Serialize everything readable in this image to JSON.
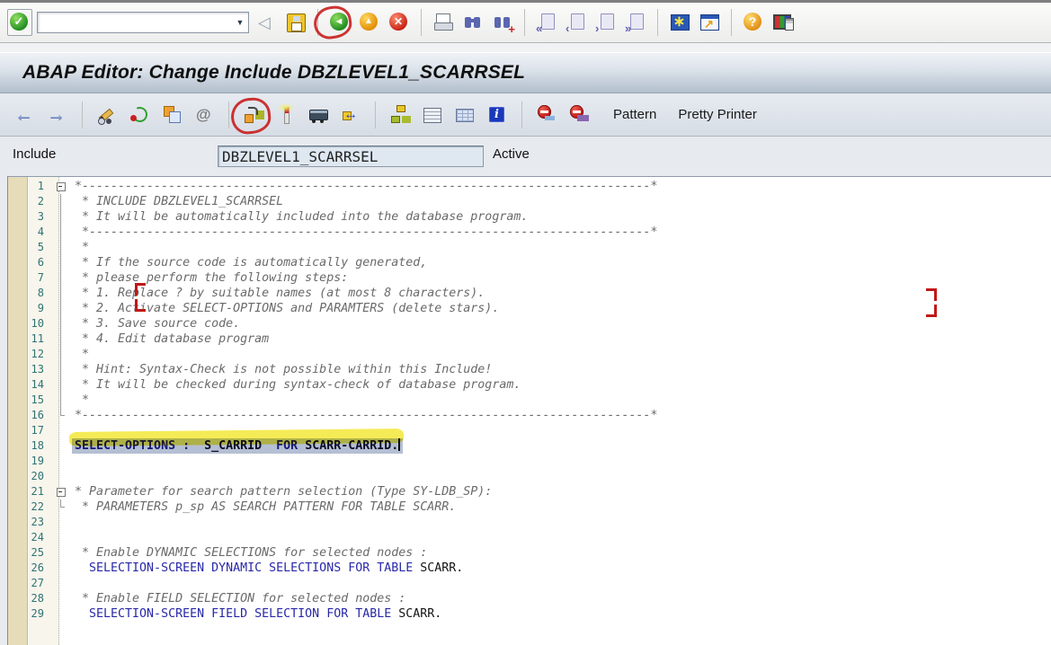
{
  "window": {
    "title": "ABAP Editor: Change Include DBZLEVEL1_SCARRSEL"
  },
  "toolbar_top": {
    "command_field": {
      "value": "",
      "placeholder": ""
    },
    "items": [
      {
        "type": "button",
        "icon": "enter-icon",
        "name": "enter-button",
        "raised": true
      },
      {
        "type": "combo"
      },
      {
        "type": "button",
        "icon": "back-icon",
        "name": "back-button"
      },
      {
        "type": "button",
        "icon": "save-icon",
        "name": "save-button"
      },
      {
        "type": "sep"
      },
      {
        "type": "button",
        "icon": "back-nav-icon",
        "name": "back-nav-button",
        "annotated": "red-circle"
      },
      {
        "type": "button",
        "icon": "exit-icon",
        "name": "exit-button"
      },
      {
        "type": "button",
        "icon": "cancel-icon",
        "name": "cancel-button"
      },
      {
        "type": "sep"
      },
      {
        "type": "button",
        "icon": "print-icon",
        "name": "print-button"
      },
      {
        "type": "button",
        "icon": "find-icon",
        "name": "find-button"
      },
      {
        "type": "button",
        "icon": "find-next-icon",
        "name": "find-next-button"
      },
      {
        "type": "sep"
      },
      {
        "type": "button",
        "icon": "first-page-icon",
        "name": "first-page-button"
      },
      {
        "type": "button",
        "icon": "previous-page-icon",
        "name": "previous-page-button"
      },
      {
        "type": "button",
        "icon": "next-page-icon",
        "name": "next-page-button"
      },
      {
        "type": "button",
        "icon": "last-page-icon",
        "name": "last-page-button"
      },
      {
        "type": "sep"
      },
      {
        "type": "button",
        "icon": "new-session-icon",
        "name": "new-session-button"
      },
      {
        "type": "button",
        "icon": "shortcut-icon",
        "name": "create-shortcut-button"
      },
      {
        "type": "sep"
      },
      {
        "type": "button",
        "icon": "help-icon",
        "name": "help-button"
      },
      {
        "type": "button",
        "icon": "customize-layout-icon",
        "name": "customize-layout-button"
      }
    ]
  },
  "app_toolbar": {
    "items": [
      {
        "type": "button",
        "icon": "nav-back-icon",
        "name": "nav-back-button"
      },
      {
        "type": "button",
        "icon": "nav-forward-icon",
        "name": "nav-forward-button"
      },
      {
        "type": "sep"
      },
      {
        "type": "button",
        "icon": "display-change-icon",
        "name": "display-change-button"
      },
      {
        "type": "button",
        "icon": "refresh-icon",
        "name": "refresh-button"
      },
      {
        "type": "button",
        "icon": "copy-icon",
        "name": "copy-button"
      },
      {
        "type": "button",
        "icon": "other-object-icon",
        "name": "other-object-button"
      },
      {
        "type": "sep"
      },
      {
        "type": "button",
        "icon": "syntax-check-icon",
        "name": "syntax-check-button"
      },
      {
        "type": "button",
        "icon": "activate-icon",
        "name": "activate-button",
        "annotated": "red-circle"
      },
      {
        "type": "button",
        "icon": "execute-icon",
        "name": "direct-processing-button"
      },
      {
        "type": "button",
        "icon": "navigation-icon",
        "name": "navigation-button"
      },
      {
        "type": "sep"
      },
      {
        "type": "button",
        "icon": "hierarchy-icon",
        "name": "object-hierarchy-button"
      },
      {
        "type": "button",
        "icon": "object-list-icon",
        "name": "object-list-button"
      },
      {
        "type": "button",
        "icon": "table-display-icon",
        "name": "table-display-button"
      },
      {
        "type": "button",
        "icon": "info-icon",
        "name": "info-button"
      },
      {
        "type": "sep"
      },
      {
        "type": "button",
        "icon": "breakpoint-screen-icon",
        "name": "breakpoint-button"
      },
      {
        "type": "button",
        "icon": "breakpoint-user-icon",
        "name": "session-breakpoint-button"
      },
      {
        "type": "text",
        "label": "Pattern",
        "name": "pattern-button"
      },
      {
        "type": "text",
        "label": "Pretty Printer",
        "name": "pretty-printer-button"
      }
    ]
  },
  "include_bar": {
    "label": "Include",
    "value": "DBZLEVEL1_SCARRSEL",
    "status": "Active"
  },
  "editor": {
    "lines": [
      {
        "n": 1,
        "fold": "box",
        "segs": [
          {
            "c": "cm",
            "t": "*-------------------------------------------------------------------------------*"
          }
        ]
      },
      {
        "n": 2,
        "fold": "line",
        "segs": [
          {
            "c": "cm",
            "t": " * INCLUDE DBZLEVEL1_SCARRSEL"
          }
        ]
      },
      {
        "n": 3,
        "fold": "line",
        "segs": [
          {
            "c": "cm",
            "t": " * It will be automatically included into the database program."
          }
        ]
      },
      {
        "n": 4,
        "fold": "line",
        "segs": [
          {
            "c": "cm",
            "t": " *------------------------------------------------------------------------------*"
          }
        ]
      },
      {
        "n": 5,
        "fold": "line",
        "segs": [
          {
            "c": "cm",
            "t": " *"
          }
        ]
      },
      {
        "n": 6,
        "fold": "line",
        "segs": [
          {
            "c": "cm",
            "t": " * If the source code is automatically generated,"
          }
        ]
      },
      {
        "n": 7,
        "fold": "line",
        "segs": [
          {
            "c": "cm",
            "t": " * please perform the following steps:"
          }
        ]
      },
      {
        "n": 8,
        "fold": "line",
        "segs": [
          {
            "c": "cm",
            "t": " * 1. Replace ? by suitable names (at most 8 characters)."
          }
        ]
      },
      {
        "n": 9,
        "fold": "line",
        "segs": [
          {
            "c": "cm",
            "t": " * 2. Activate SELECT-OPTIONS and PARAMTERS (delete stars)."
          }
        ]
      },
      {
        "n": 10,
        "fold": "line",
        "segs": [
          {
            "c": "cm",
            "t": " * 3. Save source code."
          }
        ]
      },
      {
        "n": 11,
        "fold": "line",
        "segs": [
          {
            "c": "cm",
            "t": " * 4. Edit database program"
          }
        ]
      },
      {
        "n": 12,
        "fold": "line",
        "segs": [
          {
            "c": "cm",
            "t": " *"
          }
        ]
      },
      {
        "n": 13,
        "fold": "line",
        "segs": [
          {
            "c": "cm",
            "t": " * Hint: Syntax-Check is not possible within this Include!"
          }
        ]
      },
      {
        "n": 14,
        "fold": "line",
        "segs": [
          {
            "c": "cm",
            "t": " * It will be checked during syntax-check of database program."
          }
        ]
      },
      {
        "n": 15,
        "fold": "line",
        "segs": [
          {
            "c": "cm",
            "t": " *"
          }
        ]
      },
      {
        "n": 16,
        "fold": "end",
        "segs": [
          {
            "c": "cm",
            "t": "*-------------------------------------------------------------------------------*"
          }
        ]
      },
      {
        "n": 17,
        "segs": []
      },
      {
        "n": 18,
        "sel": true,
        "marker": true,
        "caret": true,
        "segs": [
          {
            "c": "kw",
            "t": "SELECT-OPTIONS :"
          },
          {
            "c": "pl",
            "t": "  S_CARRID  "
          },
          {
            "c": "kw",
            "t": "FOR"
          },
          {
            "c": "pl",
            "t": " SCARR-CARRID."
          }
        ]
      },
      {
        "n": 19,
        "segs": []
      },
      {
        "n": 20,
        "segs": []
      },
      {
        "n": 21,
        "fold": "box",
        "segs": [
          {
            "c": "cm",
            "t": "* Parameter for search pattern selection (Type SY-LDB_SP):"
          }
        ]
      },
      {
        "n": 22,
        "fold": "end",
        "segs": [
          {
            "c": "cm",
            "t": " * PARAMETERS p_sp AS SEARCH PATTERN FOR TABLE SCARR."
          }
        ]
      },
      {
        "n": 23,
        "segs": []
      },
      {
        "n": 24,
        "segs": []
      },
      {
        "n": 25,
        "segs": [
          {
            "c": "cm",
            "t": " * Enable DYNAMIC SELECTIONS for selected nodes :"
          }
        ]
      },
      {
        "n": 26,
        "segs": [
          {
            "c": "kw",
            "t": "  SELECTION-SCREEN DYNAMIC SELECTIONS FOR TABLE"
          },
          {
            "c": "pl",
            "t": " SCARR."
          }
        ]
      },
      {
        "n": 27,
        "segs": []
      },
      {
        "n": 28,
        "segs": [
          {
            "c": "cm",
            "t": " * Enable FIELD SELECTION for selected nodes :"
          }
        ]
      },
      {
        "n": 29,
        "segs": [
          {
            "c": "kw",
            "t": "  SELECTION-SCREEN FIELD SELECTION FOR TABLE"
          },
          {
            "c": "pl",
            "t": " SCARR."
          }
        ]
      }
    ]
  },
  "annotations": {
    "pen_color": "#c01818",
    "highlighter_color": "#f2e416",
    "items": [
      "red-circle-around-back-nav-button",
      "red-circle-around-activate-button",
      "red-bracket-left-lines-8-9",
      "red-bracket-right-line-9",
      "yellow-highlighter-line-18"
    ]
  }
}
